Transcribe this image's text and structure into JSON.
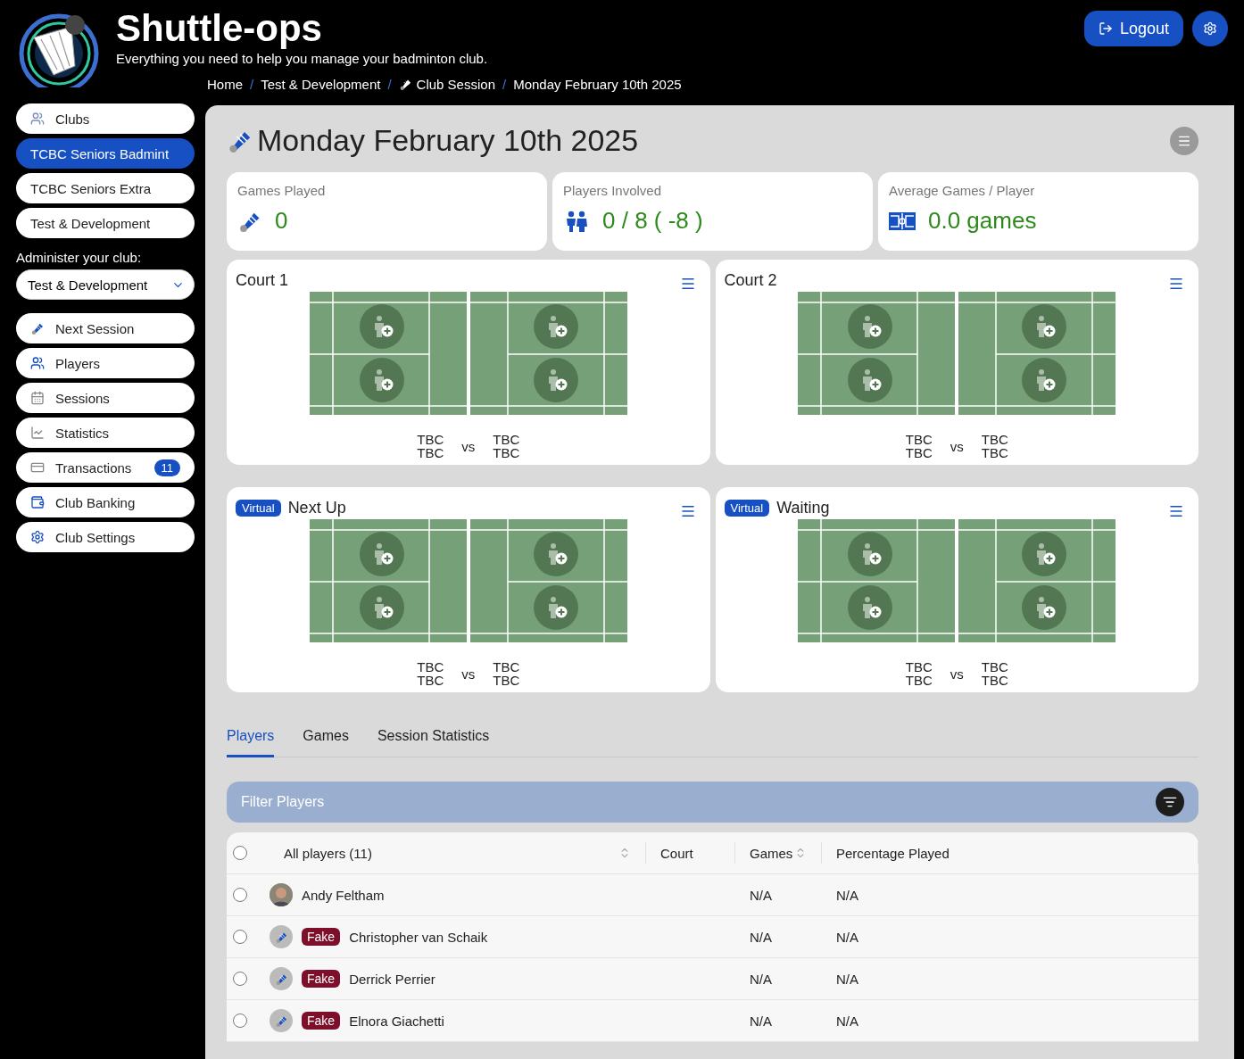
{
  "app": {
    "title": "Shuttle-ops",
    "tagline": "Everything you need to help you manage your badminton club."
  },
  "header": {
    "logout": "Logout"
  },
  "breadcrumb_separator": "/",
  "breadcrumbs": [
    {
      "label": "Home",
      "kind": "text"
    },
    {
      "label": "Test & Development",
      "kind": "text"
    },
    {
      "label": "Club Session",
      "kind": "shuttle"
    },
    {
      "label": "Monday February 10th 2025",
      "kind": "text"
    }
  ],
  "sidebar": {
    "clubs": [
      {
        "label": "Clubs",
        "kind": "heading",
        "selected": false
      },
      {
        "label": "TCBC Seniors Badmint",
        "kind": "club",
        "selected": true
      },
      {
        "label": "TCBC Seniors Extra",
        "kind": "club",
        "selected": false
      },
      {
        "label": "Test & Development",
        "kind": "club",
        "selected": false
      }
    ],
    "admin_label": "Administer your club:",
    "club_select": "Test & Development",
    "nav": [
      {
        "label": "Next Session",
        "kind": "shuttle"
      },
      {
        "label": "Players",
        "kind": "players"
      },
      {
        "label": "Sessions",
        "kind": "calendar"
      },
      {
        "label": "Statistics",
        "kind": "chart"
      },
      {
        "label": "Transactions",
        "kind": "card",
        "badge": "11"
      },
      {
        "label": "Club Banking",
        "kind": "wallet"
      },
      {
        "label": "Club Settings",
        "kind": "gear"
      }
    ]
  },
  "page": {
    "title": "Monday February 10th 2025",
    "stats": [
      {
        "label": "Games Played",
        "value": "0",
        "kind": "shuttle"
      },
      {
        "label": "Players Involved",
        "value": "0 / 8 ( -8 )",
        "kind": "people"
      },
      {
        "label": "Average Games / Player",
        "value": "0.0 games",
        "kind": "court"
      }
    ],
    "courts": [
      {
        "title": "Court 1",
        "teams": [
          [
            "TBC",
            "TBC"
          ],
          [
            "TBC",
            "TBC"
          ]
        ],
        "vs": "vs"
      },
      {
        "title": "Court 2",
        "teams": [
          [
            "TBC",
            "TBC"
          ],
          [
            "TBC",
            "TBC"
          ]
        ],
        "vs": "vs"
      },
      {
        "title": "Next Up",
        "tag": "Virtual",
        "teams": [
          [
            "TBC",
            "TBC"
          ],
          [
            "TBC",
            "TBC"
          ]
        ],
        "vs": "vs"
      },
      {
        "title": "Waiting",
        "tag": "Virtual",
        "teams": [
          [
            "TBC",
            "TBC"
          ],
          [
            "TBC",
            "TBC"
          ]
        ],
        "vs": "vs"
      }
    ],
    "tabs": [
      {
        "label": "Players",
        "selected": true
      },
      {
        "label": "Games",
        "selected": false
      },
      {
        "label": "Session Statistics",
        "selected": false
      }
    ],
    "filter": "Filter Players",
    "table": {
      "all_selected": false,
      "columns": [
        {
          "label": "All players (11)",
          "sortable": true
        },
        {
          "label": "Court",
          "sortable": false
        },
        {
          "label": "Games",
          "sortable": true
        },
        {
          "label": "Percentage Played",
          "sortable": false
        }
      ],
      "rows": [
        {
          "name": "Andy Feltham",
          "games": "N/A",
          "percentage": "N/A",
          "selected": false
        },
        {
          "name": "Christopher van Schaik",
          "kind": "shuttle",
          "badge": "Fake",
          "games": "N/A",
          "percentage": "N/A",
          "selected": false
        },
        {
          "name": "Derrick Perrier",
          "kind": "shuttle",
          "badge": "Fake",
          "games": "N/A",
          "percentage": "N/A",
          "selected": false
        },
        {
          "name": "Elnora Giachetti",
          "kind": "shuttle",
          "badge": "Fake",
          "games": "N/A",
          "percentage": "N/A",
          "selected": false
        }
      ]
    }
  }
}
